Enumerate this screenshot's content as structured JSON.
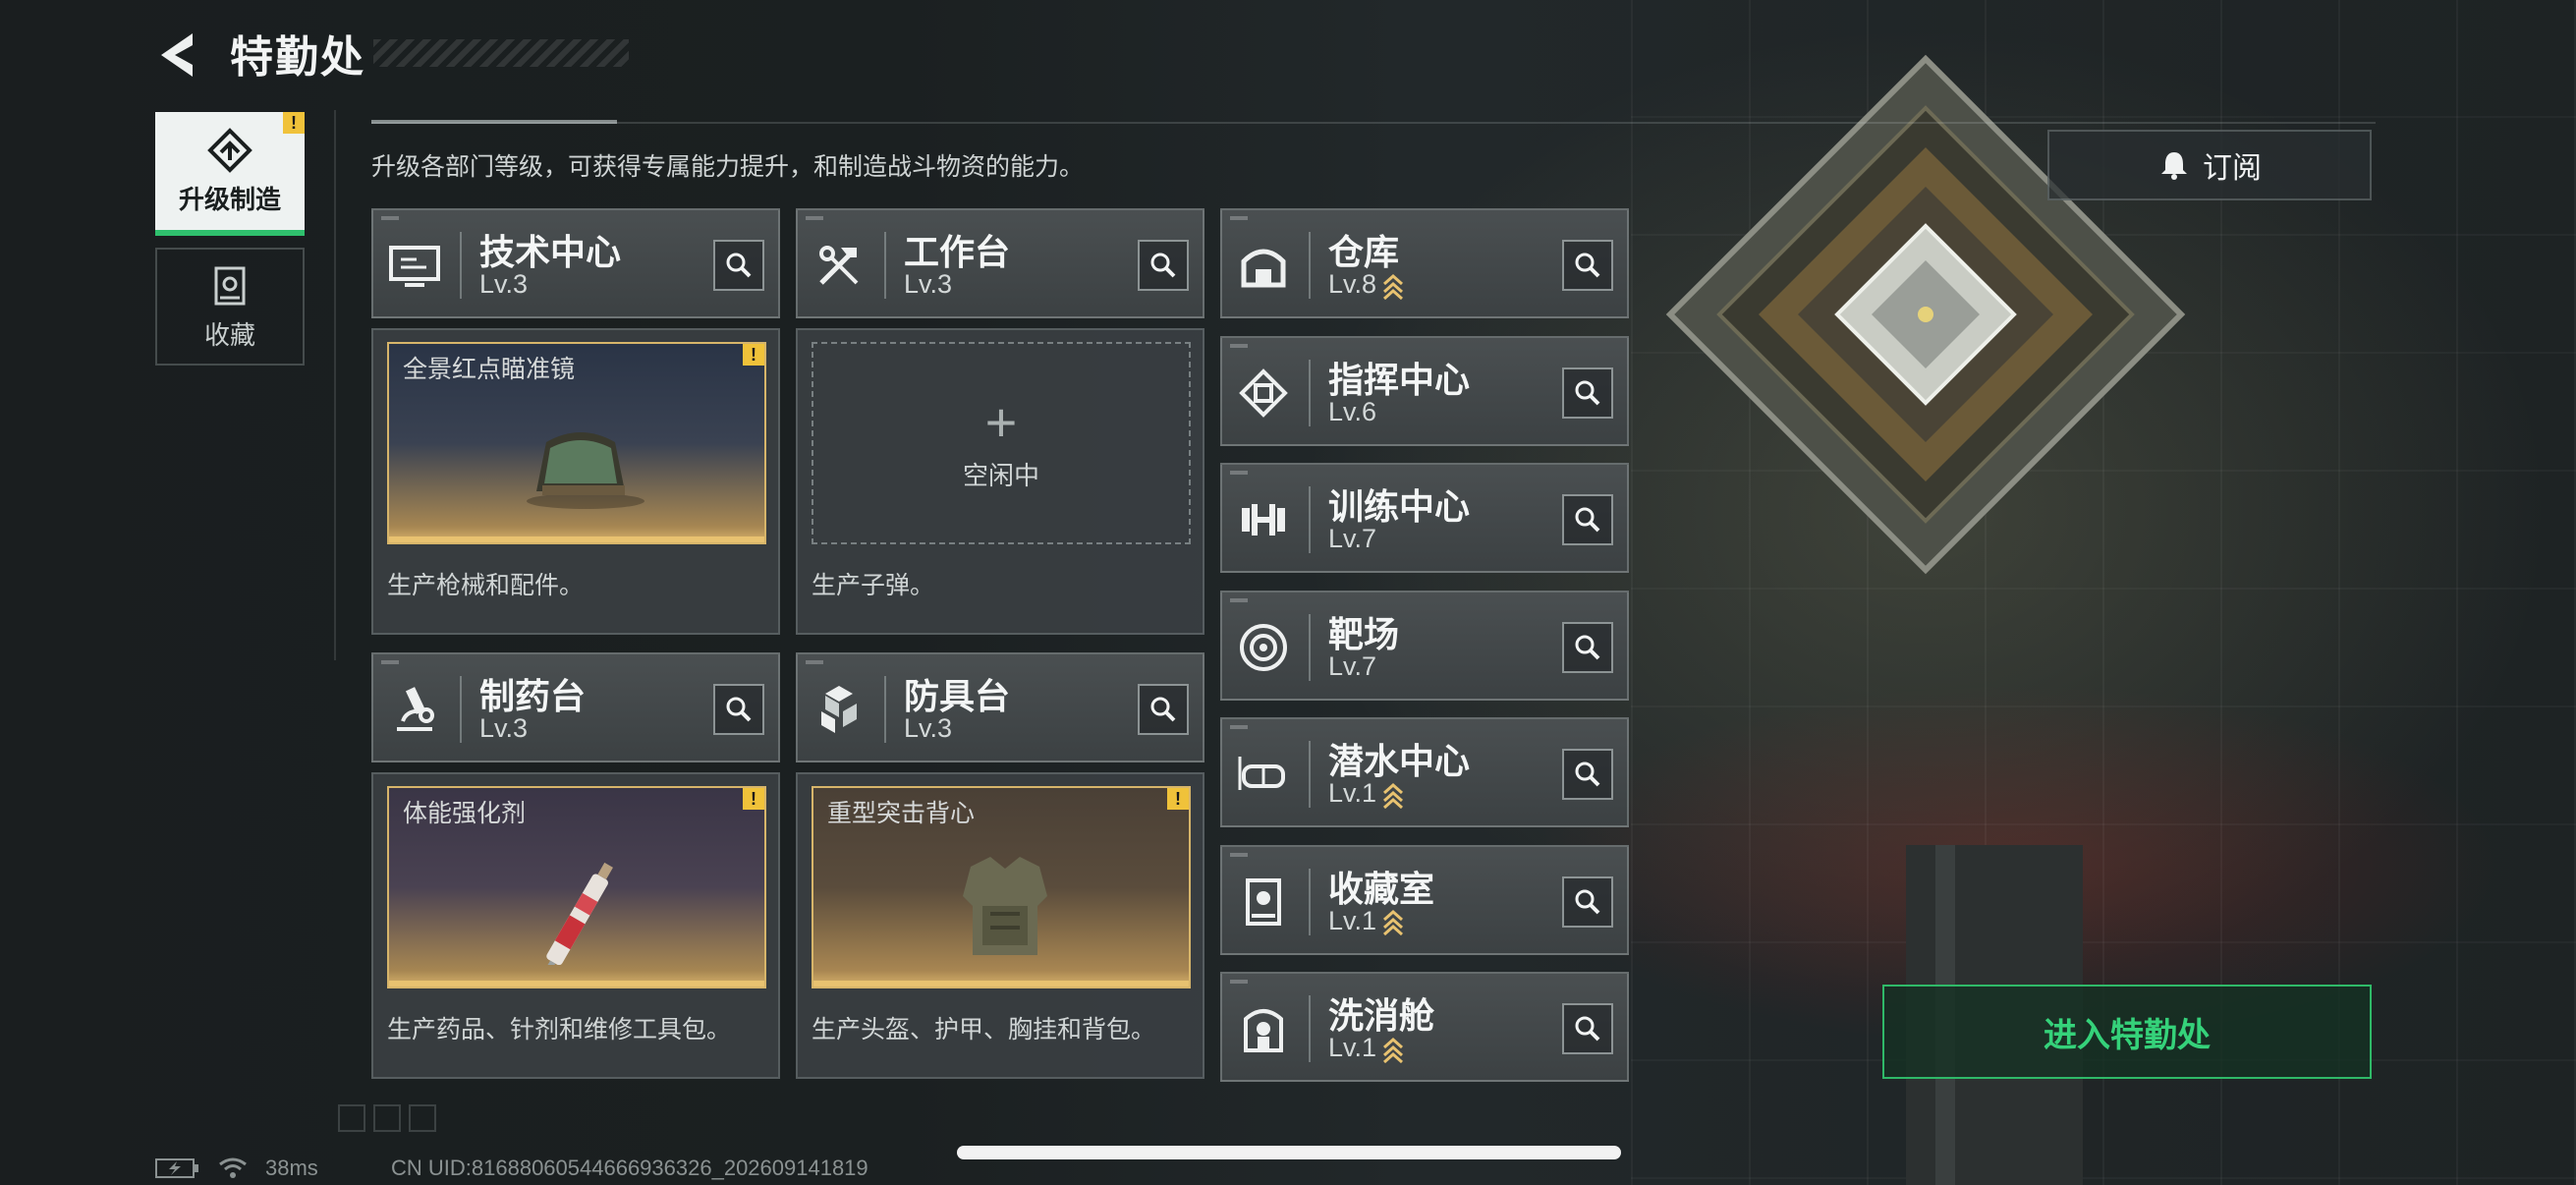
{
  "header": {
    "title": "特勤处"
  },
  "tabs": [
    {
      "label": "升级制造",
      "active": true,
      "icon": "upgrade-icon",
      "alert": "!"
    },
    {
      "label": "收藏",
      "active": false,
      "icon": "collection-icon"
    }
  ],
  "description": "升级各部门等级，可获得专属能力提升，和制造战斗物资的能力。",
  "subscribe": {
    "label": "订阅",
    "icon": "bell-icon"
  },
  "production_stations": [
    {
      "name": "技术中心",
      "level": "Lv.3",
      "icon": "monitor-icon",
      "slot": {
        "item": "全景红点瞄准镜",
        "alert": "!",
        "state": "producing"
      },
      "desc": "生产枪械和配件。"
    },
    {
      "name": "工作台",
      "level": "Lv.3",
      "icon": "tools-icon",
      "slot": {
        "item": "",
        "state": "idle",
        "idle_label": "空闲中",
        "plus": "+"
      },
      "desc": "生产子弹。"
    },
    {
      "name": "制药台",
      "level": "Lv.3",
      "icon": "microscope-icon",
      "slot": {
        "item": "体能强化剂",
        "alert": "!",
        "state": "producing"
      },
      "desc": "生产药品、针剂和维修工具包。"
    },
    {
      "name": "防具台",
      "level": "Lv.3",
      "icon": "armor-blocks-icon",
      "slot": {
        "item": "重型突击背心",
        "alert": "!",
        "state": "producing"
      },
      "desc": "生产头盔、护甲、胸挂和背包。"
    }
  ],
  "facility_list": [
    {
      "name": "仓库",
      "level": "Lv.8",
      "upgradable": true,
      "icon": "warehouse-icon"
    },
    {
      "name": "指挥中心",
      "level": "Lv.6",
      "upgradable": false,
      "icon": "chip-icon"
    },
    {
      "name": "训练中心",
      "level": "Lv.7",
      "upgradable": false,
      "icon": "dumbbell-icon"
    },
    {
      "name": "靶场",
      "level": "Lv.7",
      "upgradable": false,
      "icon": "target-icon"
    },
    {
      "name": "潜水中心",
      "level": "Lv.1",
      "upgradable": true,
      "icon": "goggles-icon"
    },
    {
      "name": "收藏室",
      "level": "Lv.1",
      "upgradable": true,
      "icon": "display-case-icon"
    },
    {
      "name": "洗消舱",
      "level": "Lv.1",
      "upgradable": true,
      "icon": "decon-chamber-icon"
    }
  ],
  "enter_button": "进入特勤处",
  "status_bar": {
    "ping": "38ms",
    "uid": "CN UID:81688060544666936326_202609141819"
  },
  "colors": {
    "accent_green": "#2fc06d",
    "warning_yellow": "#f0c23a",
    "upgrade_gold": "#e8c270"
  }
}
